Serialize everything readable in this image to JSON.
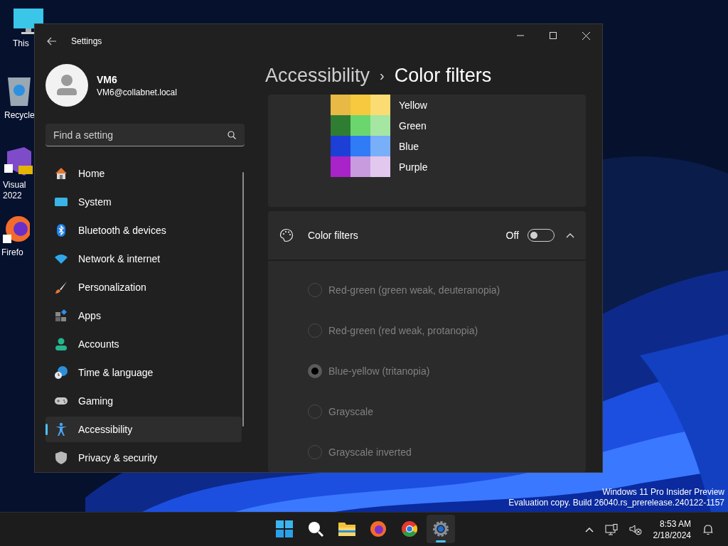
{
  "desktop_icons": [
    {
      "label": "This"
    },
    {
      "label": "Recycle"
    },
    {
      "label": "Visual\n2022"
    },
    {
      "label": "Firefo"
    }
  ],
  "window": {
    "title": "Settings"
  },
  "profile": {
    "name": "VM6",
    "email": "VM6@collabnet.local"
  },
  "search": {
    "placeholder": "Find a setting"
  },
  "sidebar": {
    "items": [
      {
        "label": "Home",
        "selected": false
      },
      {
        "label": "System",
        "selected": false
      },
      {
        "label": "Bluetooth & devices",
        "selected": false
      },
      {
        "label": "Network & internet",
        "selected": false
      },
      {
        "label": "Personalization",
        "selected": false
      },
      {
        "label": "Apps",
        "selected": false
      },
      {
        "label": "Accounts",
        "selected": false
      },
      {
        "label": "Time & language",
        "selected": false
      },
      {
        "label": "Gaming",
        "selected": false
      },
      {
        "label": "Accessibility",
        "selected": true
      },
      {
        "label": "Privacy & security",
        "selected": false
      }
    ]
  },
  "breadcrumb": {
    "parent": "Accessibility",
    "separator": "›",
    "current": "Color filters"
  },
  "swatches": [
    {
      "label": "Yellow"
    },
    {
      "label": "Green"
    },
    {
      "label": "Blue"
    },
    {
      "label": "Purple"
    }
  ],
  "color_filters": {
    "label": "Color filters",
    "state_label": "Off",
    "on": false,
    "expanded": true,
    "options": [
      {
        "label": "Red-green (green weak, deuteranopia)",
        "selected": false,
        "disabled": true
      },
      {
        "label": "Red-green (red weak, protanopia)",
        "selected": false,
        "disabled": true
      },
      {
        "label": "Blue-yellow (tritanopia)",
        "selected": true,
        "disabled": true
      },
      {
        "label": "Grayscale",
        "selected": false,
        "disabled": true
      },
      {
        "label": "Grayscale inverted",
        "selected": false,
        "disabled": true
      }
    ]
  },
  "watermark": [
    "Windows 11 Pro Insider Preview",
    "Evaluation copy. Build 26040.rs_prerelease.240122-1157"
  ],
  "taskbar": {
    "apps": [
      {
        "active": false
      },
      {
        "active": false
      },
      {
        "active": false
      },
      {
        "active": false
      },
      {
        "active": false
      },
      {
        "active": true
      }
    ],
    "time": "8:53 AM",
    "date": "2/18/2024"
  }
}
